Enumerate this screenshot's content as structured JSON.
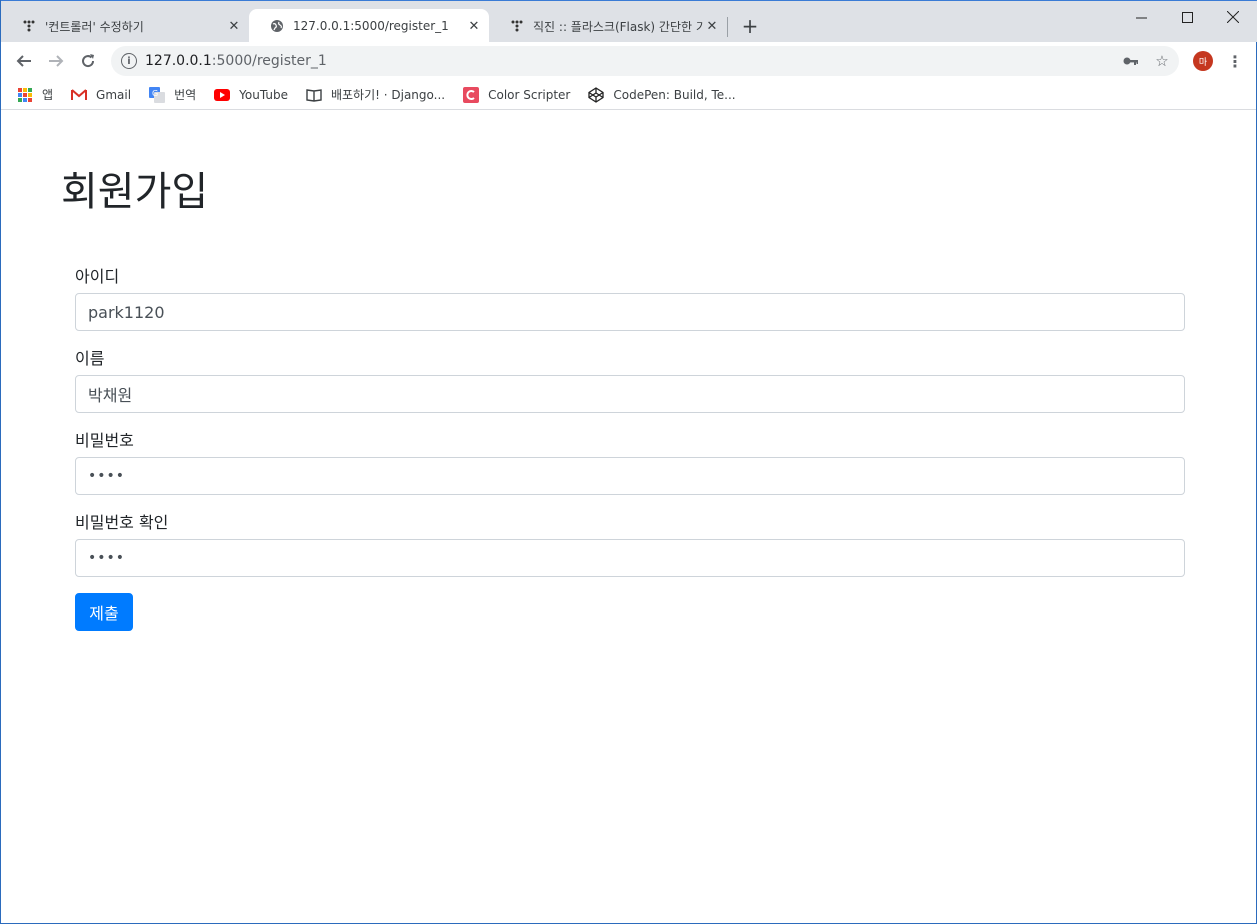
{
  "browser": {
    "tabs": [
      {
        "title": "'컨트롤러' 수정하기",
        "favicon": "tistory-icon",
        "active": false
      },
      {
        "title": "127.0.0.1:5000/register_1",
        "favicon": "globe-icon",
        "active": true
      },
      {
        "title": "직진 :: 플라스크(Flask) 간단한 기",
        "favicon": "tistory-icon",
        "active": false
      }
    ],
    "url_host": "127.0.0.1",
    "url_path": ":5000/register_1",
    "avatar_initial": "마",
    "avatar_color": "#c5371f"
  },
  "bookmarks": [
    {
      "label": "앱",
      "icon": "apps-grid-icon"
    },
    {
      "label": "Gmail",
      "icon": "gmail-icon"
    },
    {
      "label": "번역",
      "icon": "translate-icon"
    },
    {
      "label": "YouTube",
      "icon": "youtube-icon"
    },
    {
      "label": "배포하기! · Django...",
      "icon": "book-icon"
    },
    {
      "label": "Color Scripter",
      "icon": "color-scripter-icon"
    },
    {
      "label": "CodePen: Build, Te...",
      "icon": "codepen-icon"
    }
  ],
  "page": {
    "title": "회원가입",
    "fields": {
      "id_label": "아이디",
      "id_value": "park1120",
      "name_label": "이름",
      "name_value": "박채원",
      "password_label": "비밀번호",
      "password_value": "••••",
      "password_confirm_label": "비밀번호 확인",
      "password_confirm_value": "••••"
    },
    "submit_label": "제출",
    "accent_color": "#007bff"
  }
}
